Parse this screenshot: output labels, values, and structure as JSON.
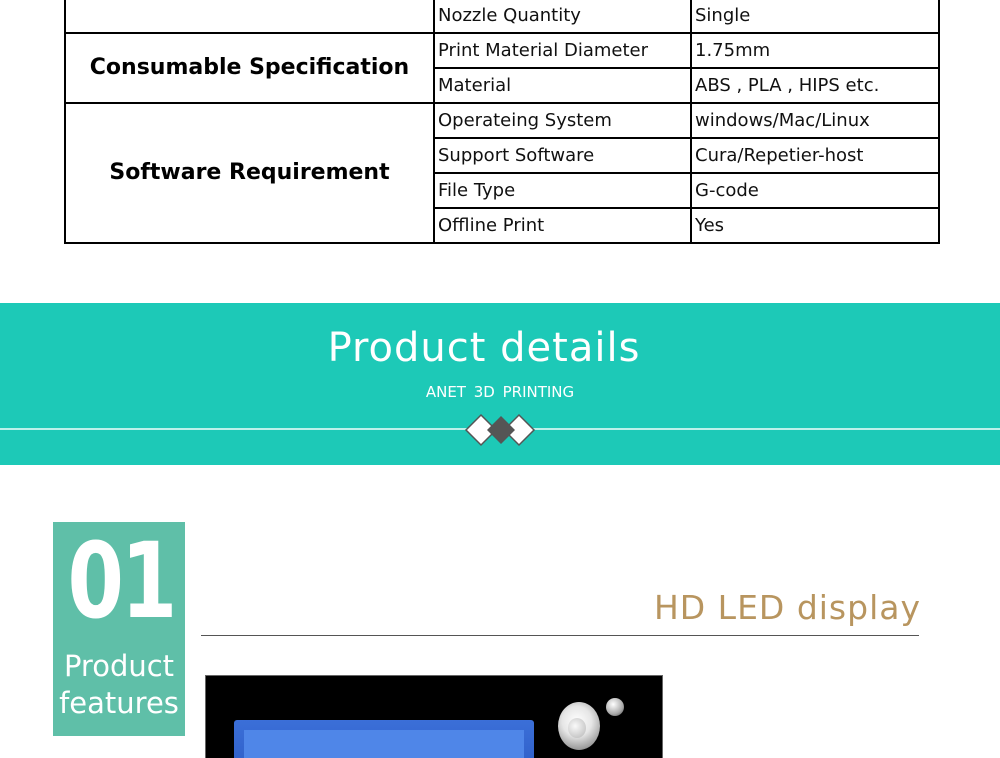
{
  "spec_table": {
    "rows": [
      {
        "label": "Nozzle Quantity",
        "value": "Single"
      },
      {
        "label": "Print Material Diameter",
        "value": "1.75mm"
      },
      {
        "label": "Material",
        "value": "ABS , PLA , HIPS etc."
      },
      {
        "label": "Operateing System",
        "value": "windows/Mac/Linux"
      },
      {
        "label": "Support Software",
        "value": "Cura/Repetier-host"
      },
      {
        "label": "File Type",
        "value": "G-code"
      },
      {
        "label": "Offline Print",
        "value": "Yes"
      }
    ],
    "categories": {
      "consumable": "Consumable Specification",
      "software": "Software Requirement"
    }
  },
  "banner": {
    "title": "Product details",
    "subtitle": "ANET 3D PRINTING",
    "color": "#1dc9b7"
  },
  "features": {
    "number": "01",
    "label": "Product features",
    "box_color": "#5fbfa8",
    "heading": "HD LED display",
    "heading_color": "#b8955f"
  }
}
